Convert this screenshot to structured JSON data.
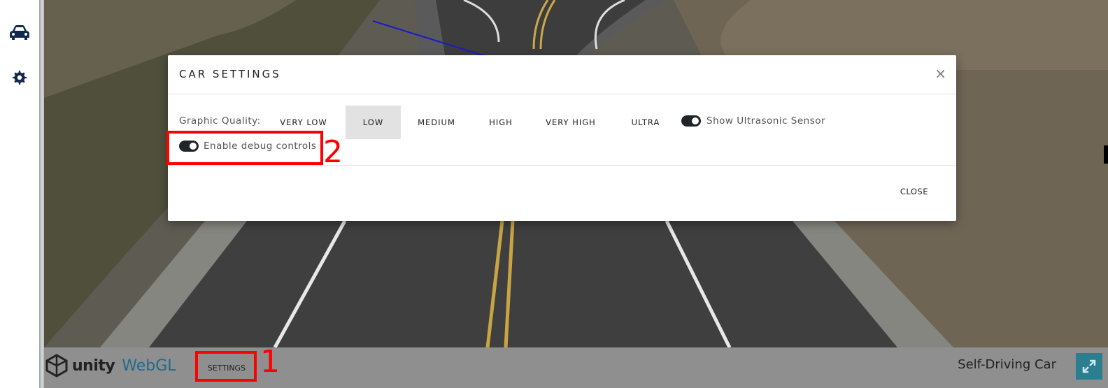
{
  "sidebar": {
    "items": [
      {
        "name": "car-icon"
      },
      {
        "name": "gear-icon"
      }
    ]
  },
  "modal": {
    "title": "CAR SETTINGS",
    "close_symbol": "×",
    "graphic_quality_label": "Graphic Quality:",
    "quality_options": [
      "VERY LOW",
      "LOW",
      "MEDIUM",
      "HIGH",
      "VERY HIGH",
      "ULTRA"
    ],
    "selected_quality": "LOW",
    "ultrasonic_label": "Show Ultrasonic Sensor",
    "ultrasonic_on": true,
    "debug_label": "Enable debug controls",
    "debug_on": true,
    "close_label": "CLOSE"
  },
  "footer": {
    "unity_text": "unity",
    "webgl_text": "WebGL",
    "settings_label": "SETTINGS",
    "app_title": "Self-Driving Car"
  },
  "annotations": {
    "label_1": "1",
    "label_2": "2",
    "color": "#ff0000"
  },
  "colors": {
    "accent_toggle": "#212529",
    "fullscreen_button": "#2a7e8f",
    "sidebar_icon": "#13294b"
  }
}
